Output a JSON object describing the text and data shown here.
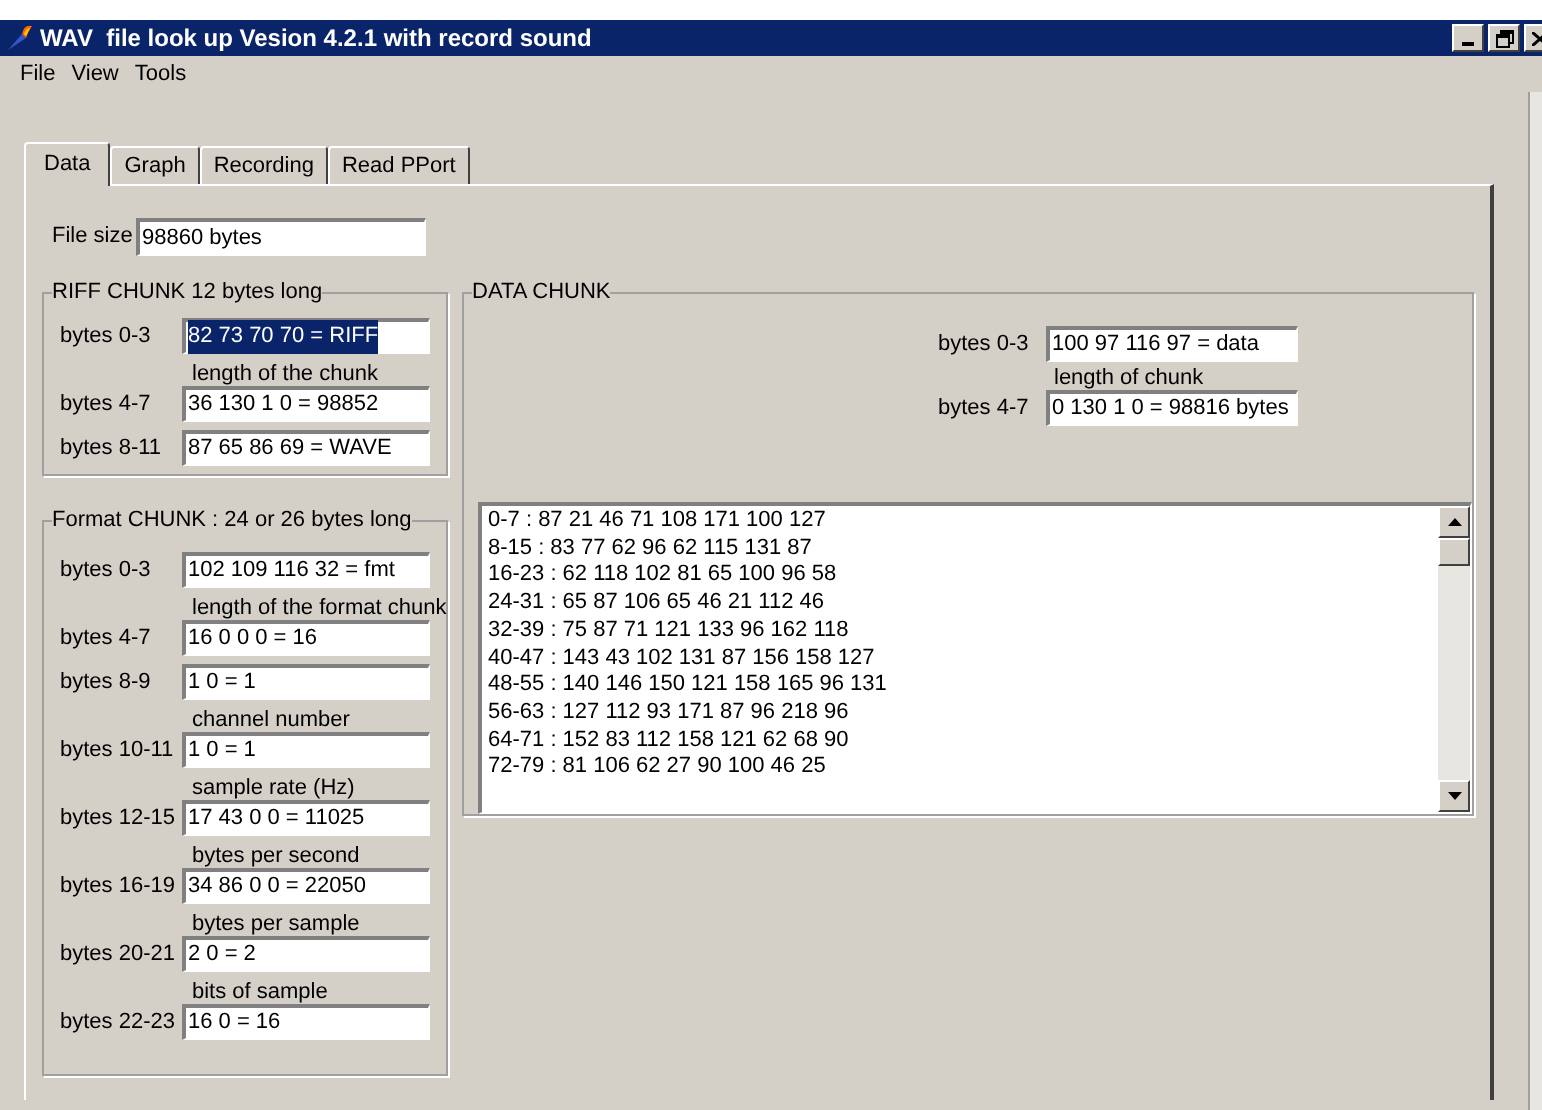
{
  "window": {
    "title": "WAV  file look up Vesion 4.2.1 with record sound"
  },
  "menu": [
    "File",
    "View",
    "Tools"
  ],
  "tabs": [
    {
      "label": "Data",
      "selected": true
    },
    {
      "label": "Graph",
      "selected": false
    },
    {
      "label": "Recording",
      "selected": false
    },
    {
      "label": "Read PPort",
      "selected": false
    }
  ],
  "file_size": {
    "label": "File size",
    "value": "98860 bytes"
  },
  "riff_chunk": {
    "title": "RIFF CHUNK 12 bytes long",
    "fields": [
      {
        "label": "bytes 0-3",
        "value": "82 73 70 70 = RIFF",
        "selected": true
      },
      {
        "caption": "length of the chunk",
        "label": "bytes 4-7",
        "value": "36 130 1 0  = 98852",
        "selected": false
      },
      {
        "label": "bytes 8-11",
        "value": "87 65 86 69 = WAVE",
        "selected": false
      }
    ]
  },
  "format_chunk": {
    "title": "Format  CHUNK : 24 or 26 bytes long",
    "fields": [
      {
        "label": "bytes 0-3",
        "value": "102 109 116 32 = fmt",
        "selected": false
      },
      {
        "caption": "length of the format chunk",
        "label": "bytes 4-7",
        "value": "16 0 0 0  = 16",
        "selected": false
      },
      {
        "label": "bytes 8-9",
        "value": "1 0  = 1",
        "selected": false
      },
      {
        "caption": "channel number",
        "label": "bytes 10-11",
        "value": "1 0  = 1",
        "selected": false
      },
      {
        "caption": "sample rate (Hz)",
        "label": "bytes 12-15",
        "value": "17 43 0 0  = 11025",
        "selected": false
      },
      {
        "caption": "bytes per second",
        "label": "bytes 16-19",
        "value": "34 86 0 0  = 22050",
        "selected": false
      },
      {
        "caption": "bytes per sample",
        "label": "bytes 20-21",
        "value": "2 0  = 2",
        "selected": false
      },
      {
        "caption": "bits of sample",
        "label": "bytes 22-23",
        "value": "16 0  = 16",
        "selected": false
      }
    ]
  },
  "data_chunk": {
    "title": "DATA CHUNK",
    "fields": [
      {
        "label": "bytes 0-3",
        "value": "100 97 116 97 = data",
        "selected": false
      },
      {
        "caption": "length of chunk",
        "label": "bytes 4-7",
        "value": "0 130 1 0  = 98816 bytes",
        "selected": false
      }
    ],
    "lines": [
      "0-7 : 87 21 46 71 108 171 100 127",
      "8-15 : 83 77 62 96 62 115 131 87",
      "16-23 : 62 118 102 81 65 100 96 58",
      "24-31 : 65 87 106 65 46 21 112 46",
      "32-39 : 75 87 71 121 133 96 162 118",
      "40-47 : 143 43 102 131 87 156 158 127",
      "48-55 : 140 146 150 121 158 165 96 131",
      "56-63 : 127 112 93 171 87 96 218 96",
      "64-71 : 152 83 112 158 121 62 68 90",
      "72-79 : 81 106 62 27 90 100 46 25"
    ]
  }
}
